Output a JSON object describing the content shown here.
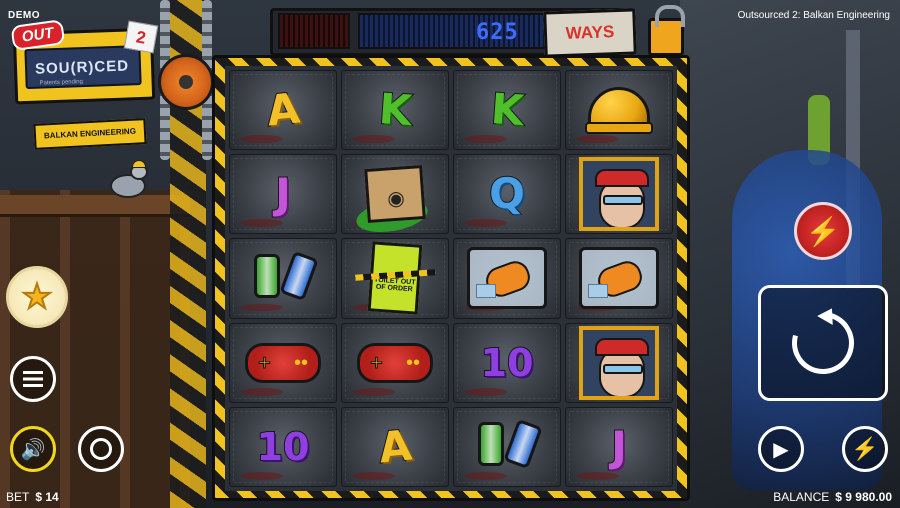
{
  "header": {
    "mode_label": "DEMO",
    "game_title": "Outsourced 2: Balkan Engineering"
  },
  "logo": {
    "out_label": "OUT",
    "main_label": "SOU(R)CED",
    "sub_label": "Patents pending",
    "number_label": "2",
    "tagline": "BALKAN ENGINEERING"
  },
  "ways": {
    "count": "625",
    "label": "WAYS"
  },
  "reels": [
    [
      "A",
      "K",
      "K",
      "helmet"
    ],
    [
      "J",
      "cardboard-box",
      "Q",
      "worker-portrait"
    ],
    [
      "soda-cans",
      "toilet-sign",
      "hand-in-bag",
      "hand-in-bag"
    ],
    [
      "gamepad",
      "gamepad",
      "10",
      "worker-portrait"
    ],
    [
      "10",
      "A",
      "soda-cans",
      "J"
    ]
  ],
  "symbol_text": {
    "toilet_sign": "TOILET OUT OF ORDER"
  },
  "icons": {
    "favorite": "star-icon",
    "menu": "hamburger-menu-icon",
    "sound": "speaker-icon",
    "bet_chip": "chip-icon",
    "turbo": "lightning-icon",
    "spin": "spin-arrow-icon",
    "autoplay": "play-icon",
    "quick_spin": "lightning-icon"
  },
  "footer": {
    "bet_label": "BET",
    "bet_value": "$ 14",
    "balance_label": "BALANCE",
    "balance_value": "$ 9 980.00"
  },
  "colors": {
    "accent_yellow": "#f1c31e",
    "turbo_red": "#d12424",
    "ways_blue": "#3d6cff",
    "ways_red": "#d8322a"
  }
}
